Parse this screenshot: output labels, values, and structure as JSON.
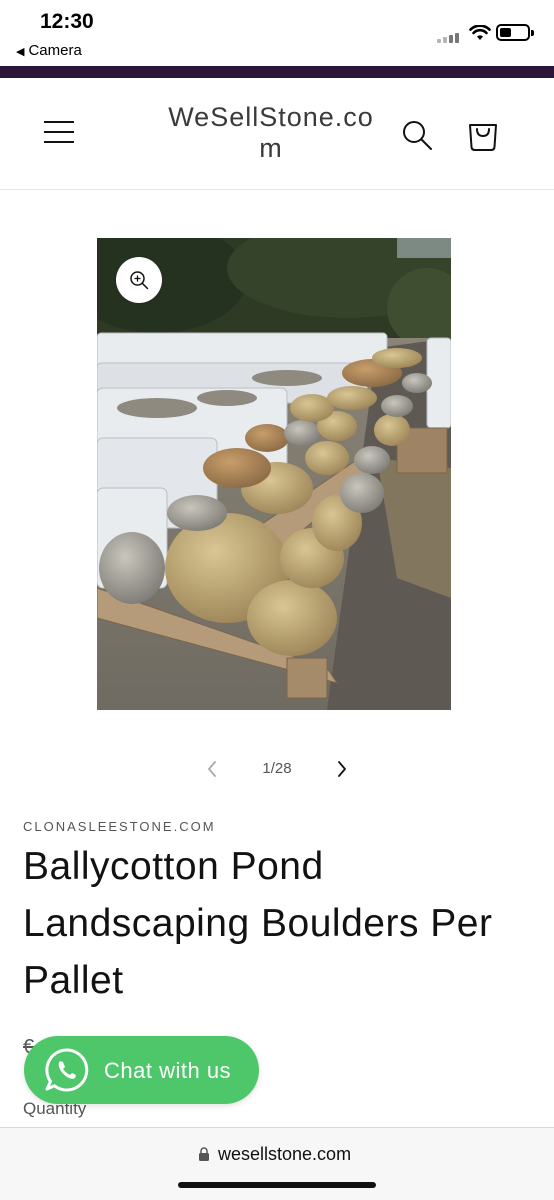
{
  "status_bar": {
    "time": "12:30",
    "back_label": "Camera"
  },
  "header": {
    "logo_text": "WeSellStone.com",
    "icons": [
      "menu-icon",
      "search-icon",
      "cart-icon"
    ]
  },
  "product": {
    "image_alt": "",
    "slide_counter": "1/28",
    "vendor": "CLONASLEESTONE.COM",
    "title": "Ballycotton Pond Landscaping Boulders Per Pallet",
    "price_stub": "€",
    "quantity_label": "Quantity"
  },
  "chat": {
    "label": "Chat with us",
    "color": "#4ec76a"
  },
  "browser": {
    "url": "wesellstone.com"
  },
  "colors": {
    "accent_band": "#2b1638"
  }
}
